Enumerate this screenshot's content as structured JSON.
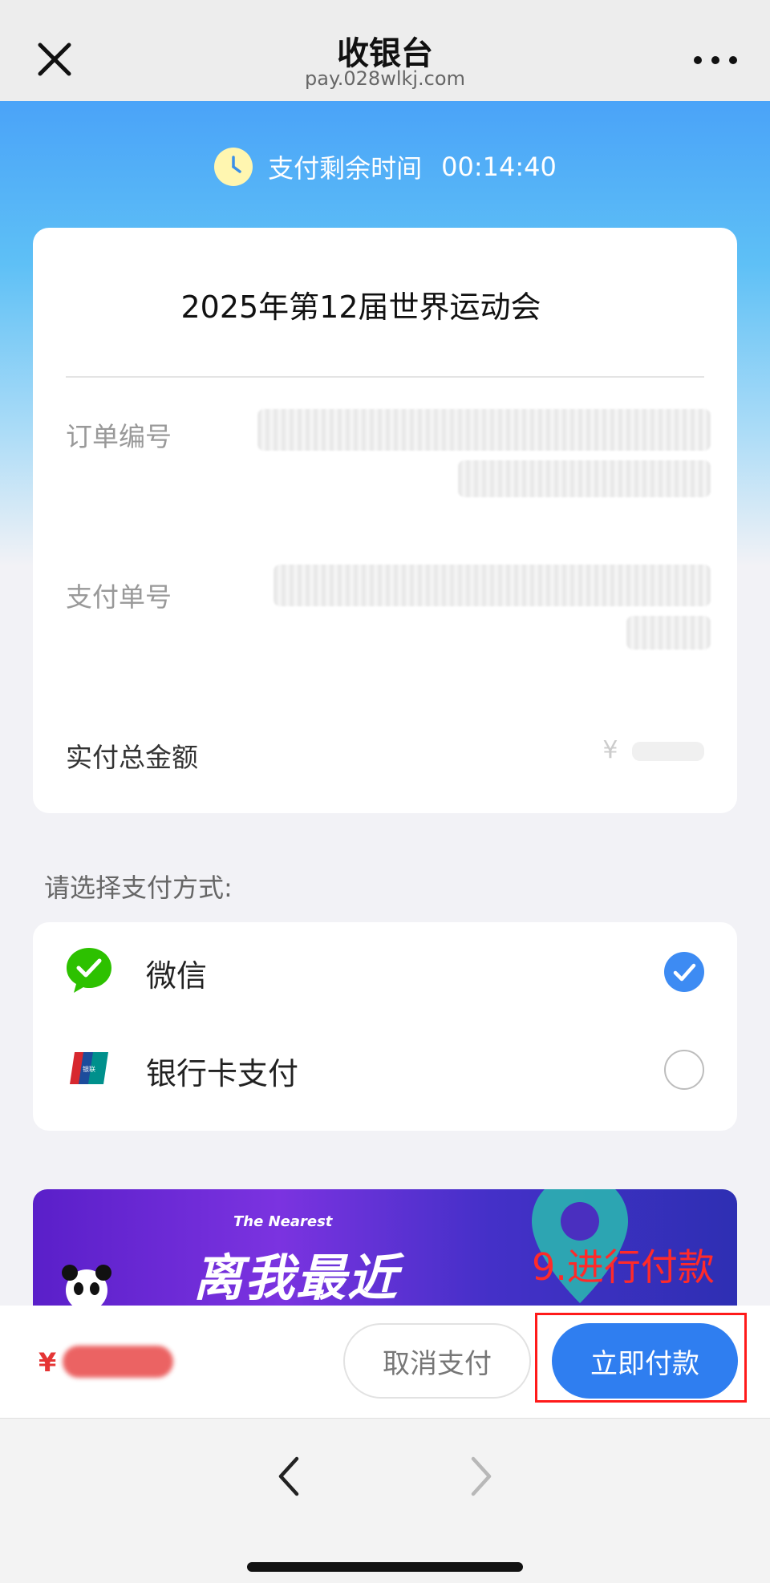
{
  "titlebar": {
    "title": "收银台",
    "url": "pay.028wlkj.com",
    "close_icon": "close-icon",
    "more_icon": "more-icon"
  },
  "timer": {
    "label": "支付剩余时间",
    "value": "00:14:40",
    "icon": "clock-icon"
  },
  "order": {
    "title": "2025年第12届世界运动会",
    "order_no_label": "订单编号",
    "pay_no_label": "支付单号",
    "amount_label": "实付总金额",
    "amount_value": "¥"
  },
  "payment": {
    "heading": "请选择支付方式:",
    "methods": [
      {
        "label": "微信",
        "icon": "wechat-icon",
        "selected": true
      },
      {
        "label": "银行卡支付",
        "icon": "unionpay-icon",
        "selected": false
      }
    ]
  },
  "banner": {
    "subtitle": "The Nearest",
    "title": "离我最近"
  },
  "annotation": {
    "text": "9.进行付款"
  },
  "action_bar": {
    "currency": "¥",
    "cancel_label": "取消支付",
    "pay_label": "立即付款"
  },
  "colors": {
    "accent": "#2f7ef0",
    "annotation": "#ff2a2a",
    "wechat_green": "#2dc100"
  }
}
